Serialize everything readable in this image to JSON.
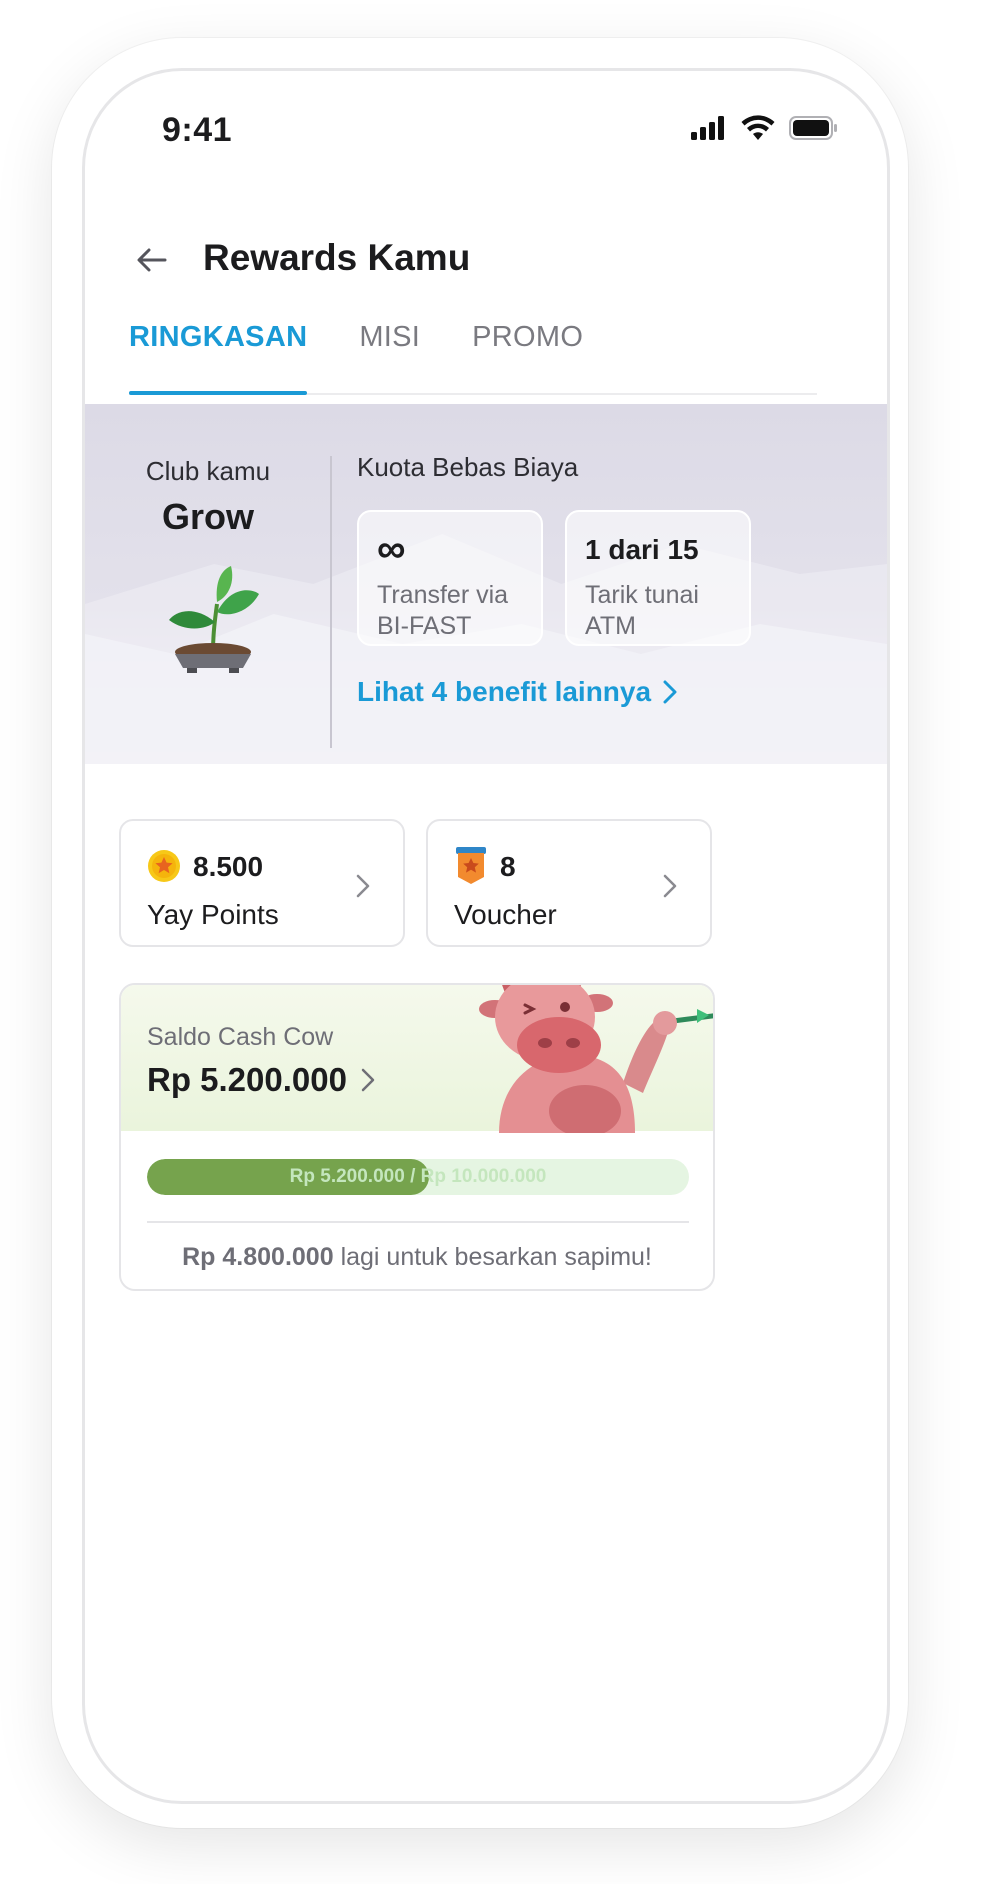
{
  "status_bar": {
    "time": "9:41",
    "icons": [
      "signal-icon",
      "wifi-icon",
      "battery-icon"
    ]
  },
  "header": {
    "title": "Rewards Kamu",
    "back_icon": "arrow-left-icon"
  },
  "tabs": [
    {
      "label": "RINGKASAN",
      "active": true
    },
    {
      "label": "MISI",
      "active": false
    },
    {
      "label": "PROMO",
      "active": false
    }
  ],
  "club": {
    "label": "Club kamu",
    "name": "Grow",
    "quota_title": "Kuota Bebas Biaya",
    "quota_cards": [
      {
        "value": "∞",
        "desc_line1": "Transfer via",
        "desc_line2": "BI-FAST"
      },
      {
        "value": "1 dari 15",
        "desc_line1": "Tarik tunai",
        "desc_line2": "ATM"
      }
    ],
    "benefit_link": "Lihat 4 benefit lainnya"
  },
  "summary": {
    "points": {
      "value": "8.500",
      "label": "Yay Points",
      "icon": "coin-star-icon"
    },
    "voucher": {
      "value": "8",
      "label": "Voucher",
      "icon": "voucher-icon"
    }
  },
  "cash_cow": {
    "label": "Saldo Cash Cow",
    "amount": "Rp 5.200.000",
    "progress_fraction": 0.52,
    "progress_current": "Rp 5.200.000",
    "progress_target": "Rp 10.000.000",
    "progress_separator": " / ",
    "remaining_amount": "Rp 4.800.000",
    "remaining_text": " lagi untuk besarkan sapimu!"
  },
  "colors": {
    "accent": "#1a9ad6",
    "progress": "#76a34d",
    "progress_track": "#e5f5e2"
  }
}
